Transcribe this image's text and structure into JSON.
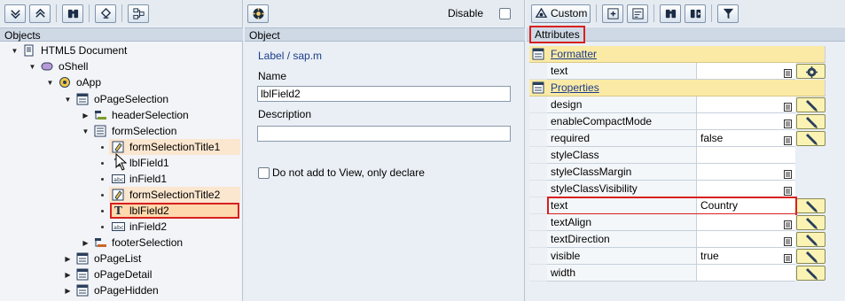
{
  "left_panel": {
    "header": "Objects",
    "tree": [
      {
        "label": "HTML5 Document",
        "icon": "document-icon",
        "toggle": "▼"
      },
      {
        "label": "oShell",
        "icon": "shell-icon",
        "toggle": "▼"
      },
      {
        "label": "oApp",
        "icon": "app-icon",
        "toggle": "▼"
      },
      {
        "label": "oPageSelection",
        "icon": "page-icon",
        "toggle": "▼"
      },
      {
        "label": "headerSelection",
        "icon": "header-icon",
        "toggle": "▶"
      },
      {
        "label": "formSelection",
        "icon": "form-icon",
        "toggle": "▼"
      },
      {
        "label": "formSelectionTitle1",
        "icon": "title-icon",
        "toggle": "•"
      },
      {
        "label": "lblField1",
        "icon": "label-icon",
        "toggle": "•"
      },
      {
        "label": "inField1",
        "icon": "input-icon",
        "toggle": "•"
      },
      {
        "label": "formSelectionTitle2",
        "icon": "title-icon",
        "toggle": "•"
      },
      {
        "label": "lblField2",
        "icon": "label-icon",
        "toggle": "•"
      },
      {
        "label": "inField2",
        "icon": "input-icon",
        "toggle": "•"
      },
      {
        "label": "footerSelection",
        "icon": "footer-icon",
        "toggle": "▶"
      },
      {
        "label": "oPageList",
        "icon": "page-icon",
        "toggle": "▶"
      },
      {
        "label": "oPageDetail",
        "icon": "page-icon",
        "toggle": "▶"
      },
      {
        "label": "oPageHidden",
        "icon": "page-icon",
        "toggle": "▶"
      }
    ],
    "icon_text_abc": "abc"
  },
  "mid_panel": {
    "disable_label": "Disable",
    "header": "Object",
    "type_link": "Label / sap.m",
    "name_label": "Name",
    "name_value": "lblField2",
    "description_label": "Description",
    "description_value": "",
    "declare_label": "Do not add to View, only declare"
  },
  "right_panel": {
    "custom_button": "Custom",
    "header": "Attributes",
    "groups": {
      "formatter": "Formatter",
      "properties": "Properties"
    },
    "formatter_rows": [
      {
        "name": "text",
        "value": ""
      }
    ],
    "property_rows": [
      {
        "name": "design",
        "value": ""
      },
      {
        "name": "enableCompactMode",
        "value": ""
      },
      {
        "name": "required",
        "value": "false"
      },
      {
        "name": "styleClass",
        "value": ""
      },
      {
        "name": "styleClassMargin",
        "value": ""
      },
      {
        "name": "styleClassVisibility",
        "value": ""
      },
      {
        "name": "text",
        "value": "Country"
      },
      {
        "name": "textAlign",
        "value": ""
      },
      {
        "name": "textDirection",
        "value": ""
      },
      {
        "name": "visible",
        "value": "true"
      },
      {
        "name": "width",
        "value": ""
      }
    ]
  },
  "colors": {
    "selection": "#fdd9ad",
    "highlight": "#fbe6cf",
    "red_box": "#d8201e",
    "group_bg": "#fbeaa5",
    "link": "#1c3c8c"
  }
}
